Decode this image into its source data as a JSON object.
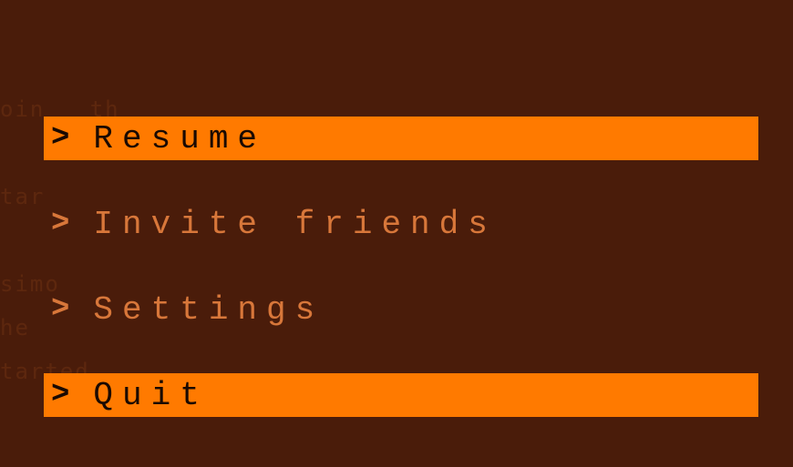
{
  "menu": {
    "items": [
      {
        "label": "Resume",
        "selected": true
      },
      {
        "label": "Invite friends",
        "selected": false
      },
      {
        "label": "Settings",
        "selected": false
      },
      {
        "label": "Quit",
        "selected": true
      }
    ],
    "chevron": ">"
  },
  "colors": {
    "background": "#4a1c0a",
    "highlight": "#ff7a00",
    "text_selected": "#1a0a02",
    "text_unselected": "#d8773a"
  }
}
